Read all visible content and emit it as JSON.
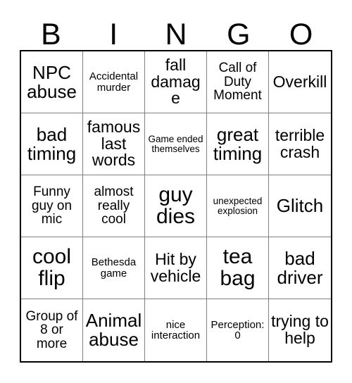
{
  "card": {
    "header_letters": [
      "B",
      "I",
      "N",
      "G",
      "O"
    ],
    "grid": {
      "rows": 5,
      "columns": 5,
      "border_color": "#000000",
      "gridline_color": "#808080",
      "background_color": "#ffffff",
      "text_color": "#000000"
    },
    "cells": [
      {
        "text": "NPC abuse",
        "size": "fs-lg",
        "row": 1,
        "column": 1
      },
      {
        "text": "Accidental murder",
        "size": "fs-xs",
        "row": 1,
        "column": 2
      },
      {
        "text": "fall damage",
        "size": "fs-md",
        "row": 1,
        "column": 3
      },
      {
        "text": "Call of Duty Moment",
        "size": "fs-sm",
        "row": 1,
        "column": 4
      },
      {
        "text": "Overkill",
        "size": "fs-md",
        "row": 1,
        "column": 5
      },
      {
        "text": "bad timing",
        "size": "fs-lg",
        "row": 2,
        "column": 1
      },
      {
        "text": "famous last words",
        "size": "fs-md",
        "row": 2,
        "column": 2
      },
      {
        "text": "Game ended themselves",
        "size": "fs-xxs",
        "row": 2,
        "column": 3
      },
      {
        "text": "great timing",
        "size": "fs-lg",
        "row": 2,
        "column": 4
      },
      {
        "text": "terrible crash",
        "size": "fs-md",
        "row": 2,
        "column": 5
      },
      {
        "text": "Funny guy on mic",
        "size": "fs-sm",
        "row": 3,
        "column": 1
      },
      {
        "text": "almost really cool",
        "size": "fs-sm",
        "row": 3,
        "column": 2
      },
      {
        "text": "guy dies",
        "size": "fs-xl",
        "row": 3,
        "column": 3
      },
      {
        "text": "unexpected explosion",
        "size": "fs-xxs",
        "row": 3,
        "column": 4
      },
      {
        "text": "Glitch",
        "size": "fs-lg",
        "row": 3,
        "column": 5
      },
      {
        "text": "cool flip",
        "size": "fs-xl",
        "row": 4,
        "column": 1
      },
      {
        "text": "Bethesda game",
        "size": "fs-xs",
        "row": 4,
        "column": 2
      },
      {
        "text": "Hit by vehicle",
        "size": "fs-md",
        "row": 4,
        "column": 3
      },
      {
        "text": "tea bag",
        "size": "fs-xl",
        "row": 4,
        "column": 4
      },
      {
        "text": "bad driver",
        "size": "fs-lg",
        "row": 4,
        "column": 5
      },
      {
        "text": "Group of 8 or more",
        "size": "fs-sm",
        "row": 5,
        "column": 1
      },
      {
        "text": "Animal abuse",
        "size": "fs-lg",
        "row": 5,
        "column": 2
      },
      {
        "text": "nice interaction",
        "size": "fs-xs",
        "row": 5,
        "column": 3
      },
      {
        "text": "Perception: 0",
        "size": "fs-xs",
        "row": 5,
        "column": 4
      },
      {
        "text": "trying to help",
        "size": "fs-md",
        "row": 5,
        "column": 5
      }
    ]
  }
}
